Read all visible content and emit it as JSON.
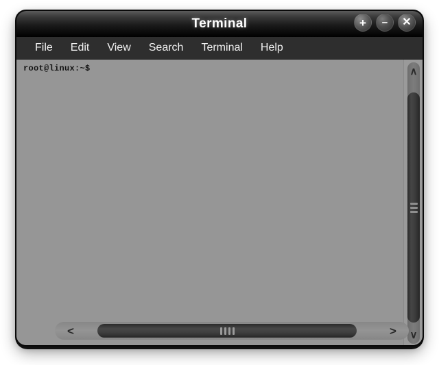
{
  "window": {
    "title": "Terminal",
    "controls": [
      {
        "name": "maximize-button",
        "glyph": "+"
      },
      {
        "name": "minimize-button",
        "glyph": "−"
      },
      {
        "name": "close-button",
        "glyph": "✕"
      }
    ]
  },
  "menu_bar": {
    "items": [
      {
        "label": "File"
      },
      {
        "label": "Edit"
      },
      {
        "label": "View"
      },
      {
        "label": "Search"
      },
      {
        "label": "Terminal"
      },
      {
        "label": "Help"
      }
    ]
  },
  "terminal": {
    "prompt": "root@linux:~$",
    "background_color": "#969696",
    "text_color": "#141414"
  },
  "scrollbars": {
    "vertical": {
      "up_arrow_glyph": "∧",
      "down_arrow_glyph": "∨",
      "grip_count": 3
    },
    "horizontal": {
      "left_arrow_glyph": "<",
      "right_arrow_glyph": ">",
      "grip_count": 4
    }
  },
  "colors": {
    "titlebar_top": "#5c5c5c",
    "titlebar_bottom": "#000000",
    "menubar": "#2e2e2e",
    "thumb": "#3a3a3a",
    "trough": "#7d7d7d",
    "page_background": "#ffffff"
  }
}
